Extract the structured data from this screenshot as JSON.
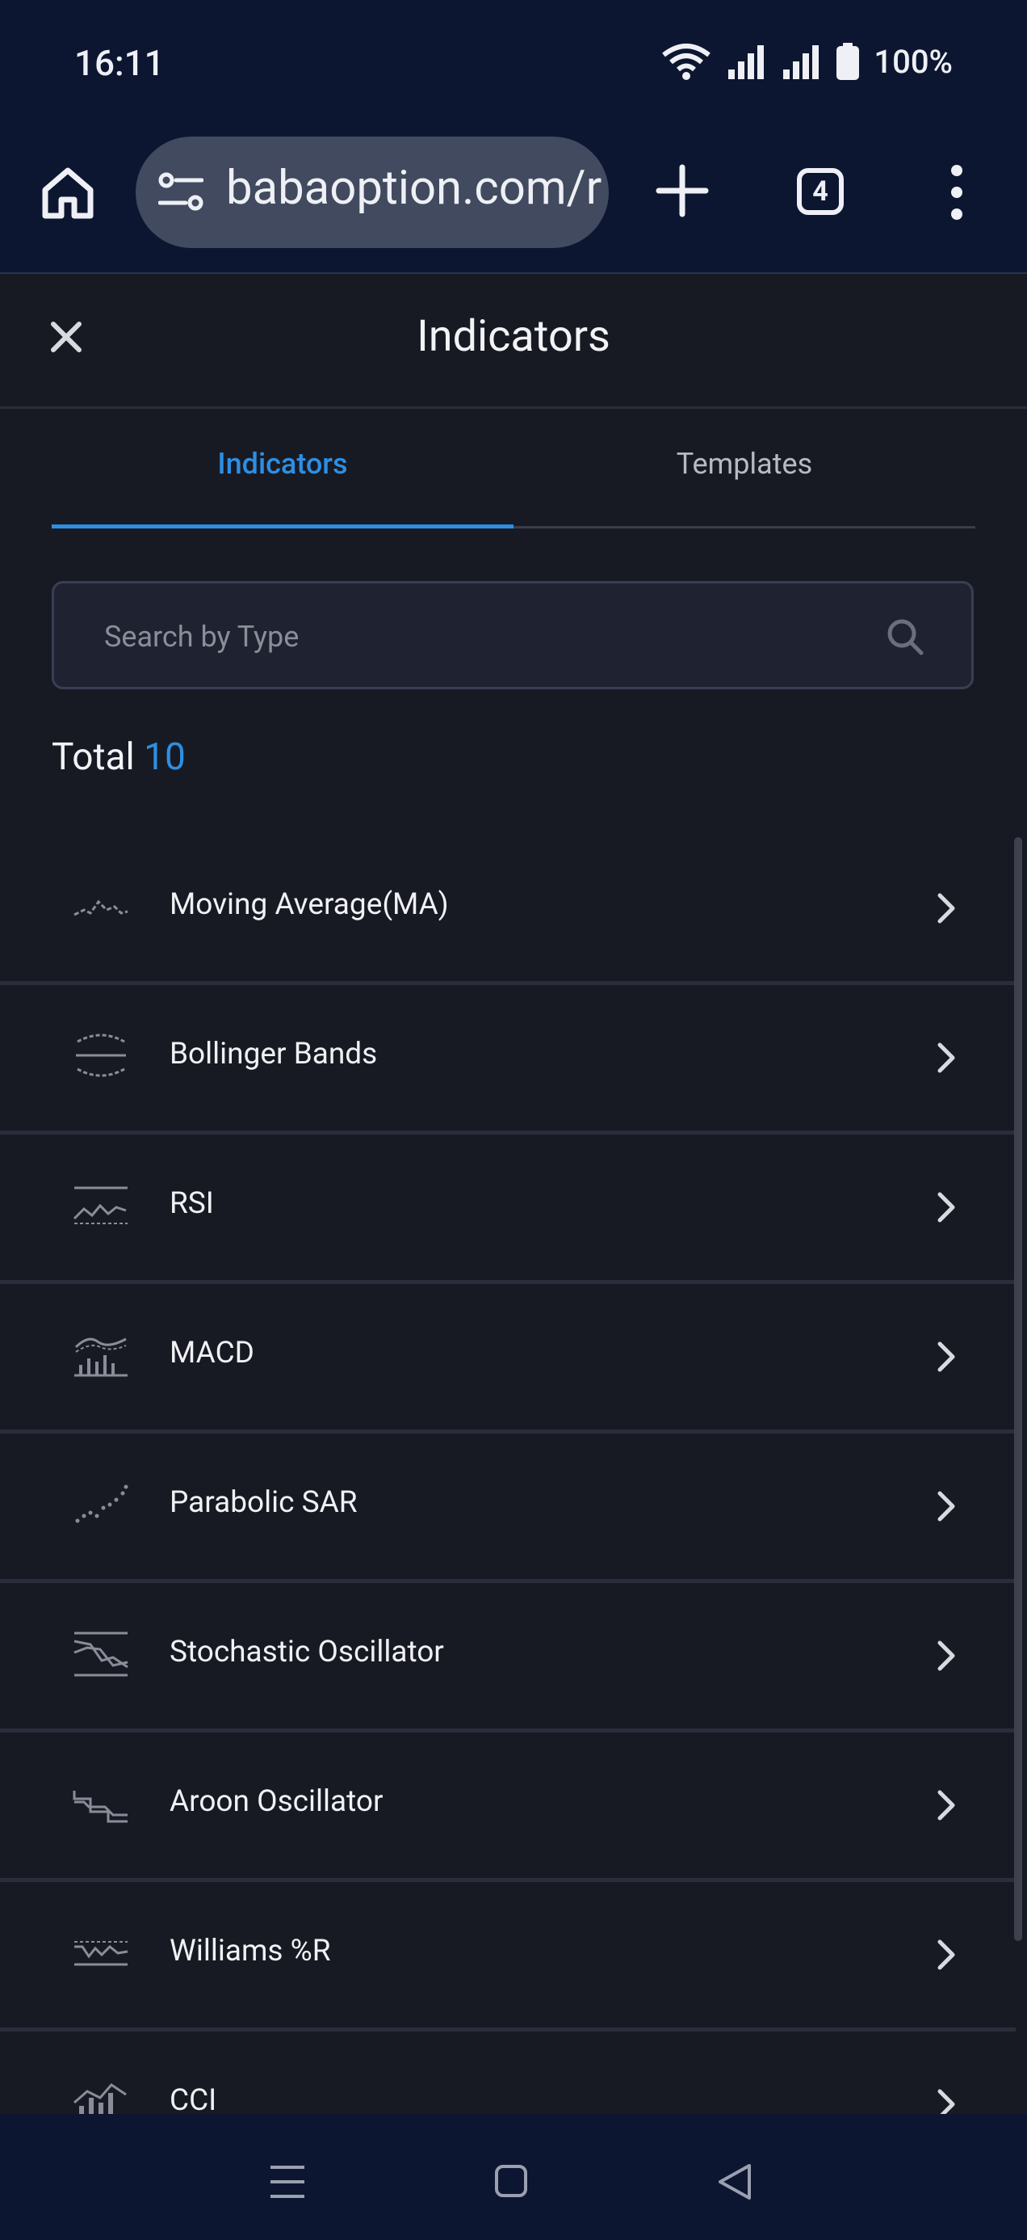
{
  "status_bar": {
    "time": "16:11",
    "battery": "100%"
  },
  "browser": {
    "url": "babaoption.com/r",
    "tab_count": "4"
  },
  "header": {
    "title": "Indicators"
  },
  "tabs": [
    {
      "label": "Indicators"
    },
    {
      "label": "Templates"
    }
  ],
  "search": {
    "placeholder": "Search by Type"
  },
  "total": {
    "label": "Total",
    "count": "10"
  },
  "indicators": [
    {
      "label": "Moving Average(MA)"
    },
    {
      "label": "Bollinger Bands"
    },
    {
      "label": "RSI"
    },
    {
      "label": "MACD"
    },
    {
      "label": "Parabolic SAR"
    },
    {
      "label": "Stochastic Oscillator"
    },
    {
      "label": "Aroon Oscillator"
    },
    {
      "label": "Williams %R"
    },
    {
      "label": "CCI"
    }
  ],
  "colors": {
    "accent": "#2d8fe4",
    "background": "#181a23",
    "bar": "#0d1631"
  }
}
